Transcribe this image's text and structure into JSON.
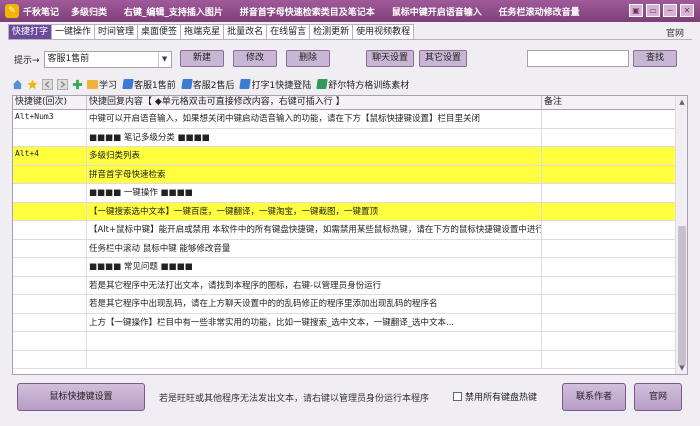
{
  "titlebar": {
    "app_title": "千秋笔记",
    "menu": [
      "多级归类",
      "右键_编辑_支持插入图片",
      "拼音首字母快速检索类目及笔记本",
      "鼠标中键开启语音输入",
      "任务栏滚动修改音量"
    ],
    "buttons": [
      "▣",
      "▭",
      "─",
      "✕"
    ]
  },
  "tabs": [
    "快捷打字",
    "一键操作",
    "时间管理",
    "桌面便签",
    "拖端克星",
    "批量改名",
    "在线留言",
    "检测更新",
    "使用视频教程"
  ],
  "official_link": "官网",
  "toolbar": {
    "hint_label": "提示→",
    "combo_value": "客服1售前",
    "new_label": "新建",
    "edit_label": "修改",
    "delete_label": "删除",
    "chat_settings_label": "聊天设置",
    "other_settings_label": "其它设置",
    "search_value": "",
    "search_label": "查找"
  },
  "categories": [
    {
      "icon": "folder-icon",
      "label": "学习"
    },
    {
      "icon": "book-icon",
      "label": "客服1售前"
    },
    {
      "icon": "book-icon",
      "label": "客服2售后"
    },
    {
      "icon": "book-icon",
      "label": "打字1快捷登陆"
    },
    {
      "icon": "book-green-icon",
      "label": "舒尔特方格训练素材"
    }
  ],
  "table": {
    "headers": [
      "快捷键(回次)",
      "快捷回复内容【 ◆单元格双击可直接修改内容，右键可插入行 】",
      "备注"
    ],
    "rows": [
      {
        "key": "Alt+Num3",
        "content": "中键可以开启语音输入，如果想关闭中键启动语音输入的功能，请在下方【鼠标快捷键设置】栏目里关闭",
        "note": "",
        "highlight": false
      },
      {
        "key": "",
        "content": "■■■■  笔记多级分类  ■■■■",
        "note": "",
        "highlight": false
      },
      {
        "key": "Alt+4",
        "content": "多级归类列表",
        "note": "",
        "highlight": true
      },
      {
        "key": "",
        "content": "拼音首字母快速检索",
        "note": "",
        "highlight": true
      },
      {
        "key": "",
        "content": "■■■■  一键操作  ■■■■",
        "note": "",
        "highlight": false
      },
      {
        "key": "",
        "content": "【一键搜索选中文本】一键百度，一键翻译，一键淘宝，一键截图，一键置顶",
        "note": "",
        "highlight": true
      },
      {
        "key": "",
        "content": "【Alt+鼠标中键】能开启或禁用 本软件中的所有键盘快捷键，如需禁用某些鼠标热键，请在下方的鼠标快捷键设置中进行设置",
        "note": "",
        "highlight": false
      },
      {
        "key": "",
        "content": "任务栏中滚动 鼠标中键 能够修改音量",
        "note": "",
        "highlight": false
      },
      {
        "key": "",
        "content": "■■■■  常见问题  ■■■■",
        "note": "",
        "highlight": false
      },
      {
        "key": "",
        "content": "若是其它程序中无法打出文本，请找到本程序的图标，右键-以管理员身份运行",
        "note": "",
        "highlight": false
      },
      {
        "key": "",
        "content": "若是其它程序中出现乱码，请在上方聊天设置中的的乱码修正的程序里添加出现乱码的程序名",
        "note": "",
        "highlight": false
      },
      {
        "key": "",
        "content": "上方【一键操作】栏目中有一些非常实用的功能，比如一键搜索_选中文本，一键翻译_选中文本...",
        "note": "",
        "highlight": false
      },
      {
        "key": "",
        "content": "",
        "note": "",
        "highlight": false
      },
      {
        "key": "",
        "content": "",
        "note": "",
        "highlight": false
      }
    ]
  },
  "bottom": {
    "mouse_shortcut_label": "鼠标快捷键设置",
    "warning_text": "若是旺旺或其他程序无法发出文本，请右键以管理员身份运行本程序",
    "disable_hotkeys_label": "禁用所有键盘热键",
    "contact_author_label": "联系作者",
    "official_site_label": "官网"
  },
  "colors": {
    "titlebar": "#7d3f78",
    "active_tab": "#6a4a9a",
    "highlight_row": "#ffff40",
    "button": "#c8b6d4"
  }
}
